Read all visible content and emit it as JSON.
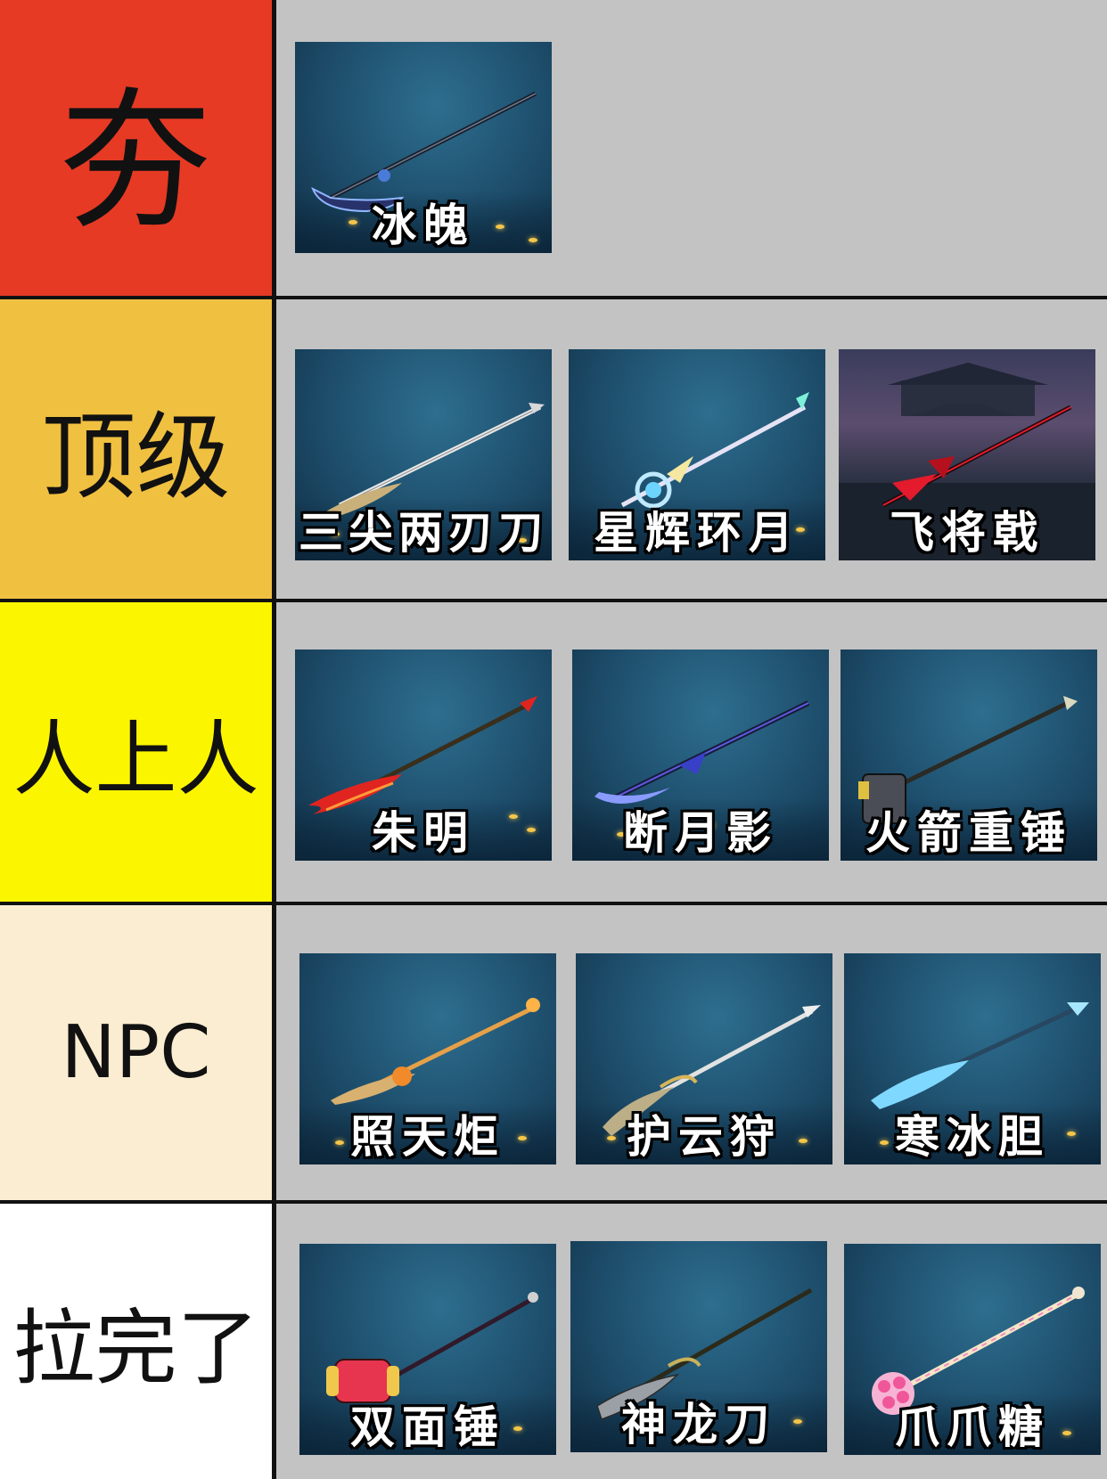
{
  "tiers": [
    {
      "label": "夯",
      "color": "#e63a24",
      "items": [
        {
          "name": "冰魄",
          "icon": "ice-scythe-spear-icon",
          "accent": "#4a7bd8"
        }
      ]
    },
    {
      "label": "顶级",
      "color": "#f0c040",
      "items": [
        {
          "name": "三尖两刃刀",
          "icon": "trident-glaive-icon",
          "accent": "#d8d8d8"
        },
        {
          "name": "星辉环月",
          "icon": "star-moon-spear-icon",
          "accent": "#bfe9ff"
        },
        {
          "name": "飞将戟",
          "icon": "crimson-halberd-icon",
          "accent": "#e31b2c"
        }
      ]
    },
    {
      "label": "人上人",
      "color": "#fcf500",
      "items": [
        {
          "name": "朱明",
          "icon": "flame-glaive-icon",
          "accent": "#e02420"
        },
        {
          "name": "断月影",
          "icon": "moon-shadow-glaive-icon",
          "accent": "#5a5ce0"
        },
        {
          "name": "火箭重锤",
          "icon": "rocket-hammer-icon",
          "accent": "#e0c040"
        }
      ]
    },
    {
      "label": "NPC",
      "color": "#fbedd1",
      "items": [
        {
          "name": "照天炬",
          "icon": "sun-torch-spear-icon",
          "accent": "#f08a2a"
        },
        {
          "name": "护云狩",
          "icon": "cloud-guard-glaive-icon",
          "accent": "#d6b45a"
        },
        {
          "name": "寒冰胆",
          "icon": "frost-glaive-icon",
          "accent": "#7fd8ff"
        }
      ]
    },
    {
      "label": "拉完了",
      "color": "#ffffff",
      "items": [
        {
          "name": "双面锤",
          "icon": "double-hammer-icon",
          "accent": "#e8354f"
        },
        {
          "name": "神龙刀",
          "icon": "dragon-blade-icon",
          "accent": "#c9b25a"
        },
        {
          "name": "爪爪糖",
          "icon": "paw-candy-staff-icon",
          "accent": "#f28ac0"
        }
      ]
    }
  ]
}
